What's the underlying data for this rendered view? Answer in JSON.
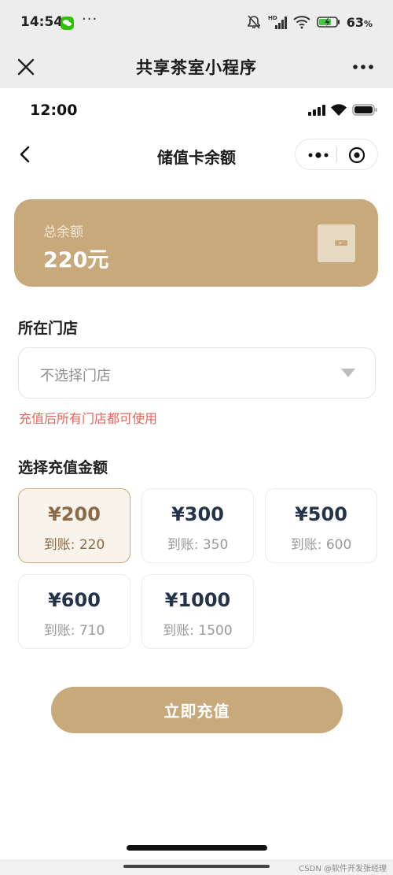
{
  "os_status": {
    "time": "14:54",
    "more": "···",
    "battery_pct": "63",
    "battery_unit": "%"
  },
  "host": {
    "title": "共享茶室小程序"
  },
  "inner_status": {
    "time": "12:00"
  },
  "nav": {
    "title": "储值卡余额"
  },
  "balance": {
    "label": "总余额",
    "amount": "220元"
  },
  "store": {
    "section_title": "所在门店",
    "value": "不选择门店",
    "hint": "充值后所有门店都可使用"
  },
  "amounts": {
    "section_title": "选择充值金额",
    "options": [
      {
        "price": "¥200",
        "credit": "到账: 220",
        "selected": true
      },
      {
        "price": "¥300",
        "credit": "到账: 350",
        "selected": false
      },
      {
        "price": "¥500",
        "credit": "到账: 600",
        "selected": false
      },
      {
        "price": "¥600",
        "credit": "到账: 710",
        "selected": false
      },
      {
        "price": "¥1000",
        "credit": "到账: 1500",
        "selected": false
      }
    ]
  },
  "actions": {
    "recharge_label": "立即充值"
  },
  "watermark": "CSDN @软件开发张经理",
  "colors": {
    "accent": "#c8a97c",
    "accent_text": "#8c6a45",
    "hint_red": "#e0655a",
    "price_text": "#24324a"
  },
  "icons": {
    "wechat": "wechat-icon",
    "host_close": "close-icon",
    "host_more": "more-icon",
    "back": "chevron-left-icon",
    "capsule_menu": "menu-dots-icon",
    "capsule_close": "circle-target-icon",
    "wallet": "wallet-icon",
    "caret": "caret-down-icon"
  }
}
